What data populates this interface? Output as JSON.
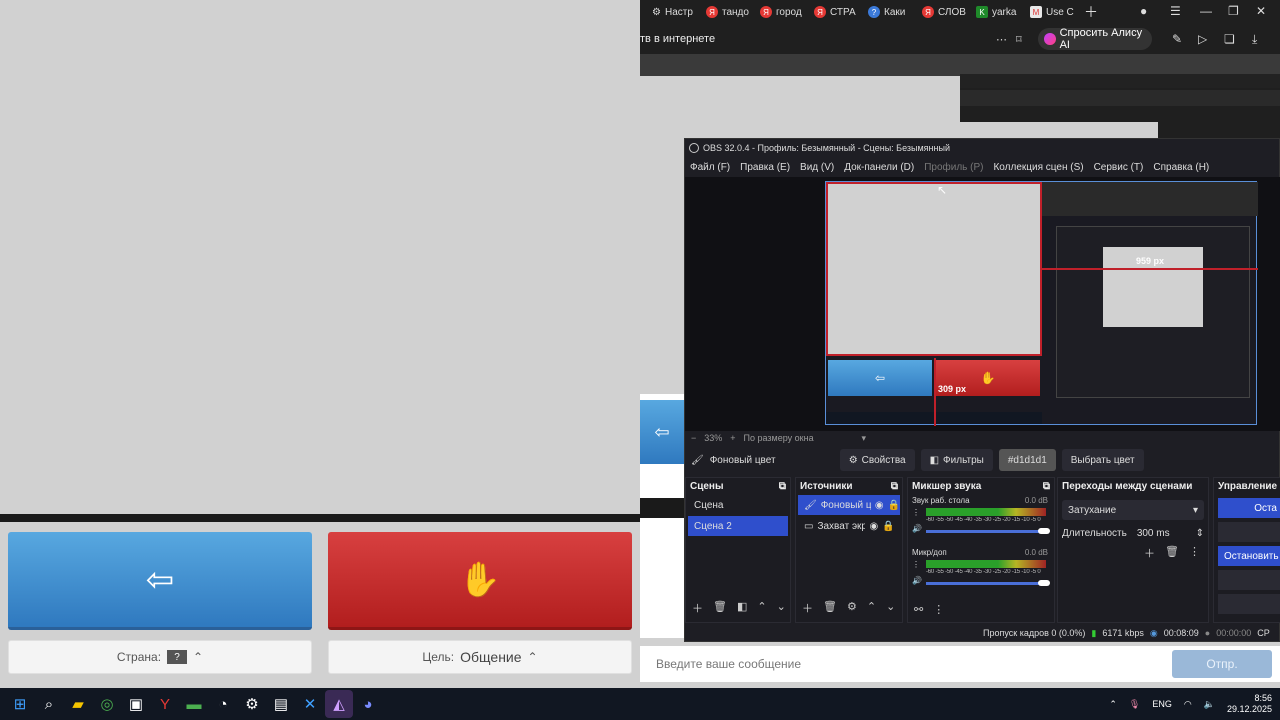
{
  "left": {
    "country_label": "Страна:",
    "country_value": "?",
    "goal_label": "Цель:",
    "goal_value": "Общение"
  },
  "chat": {
    "message_placeholder": "Введите ваше сообщение",
    "send_label": "Отпр."
  },
  "browser": {
    "tabs": [
      "Настр",
      "тандо",
      "город",
      "СТРА",
      "Каки",
      "СЛОВ",
      "yarka",
      "Use C"
    ],
    "address_text": "тв в интернете",
    "alice_label": "Спросить Алису AI"
  },
  "obs": {
    "title": "OBS 32.0.4 - Профиль: Безымянный - Сцены: Безымянный",
    "menu": [
      "Файл (F)",
      "Правка (E)",
      "Вид (V)",
      "Док-панели (D)",
      "Профиль (P)",
      "Коллекция сцен (S)",
      "Сервис (T)",
      "Справка (H)"
    ],
    "zoom": "33%",
    "fit_label": "По размеру окна",
    "dimension_top": "959 px",
    "dimension_left": "309 px",
    "prop_source": "Фоновый цвет",
    "properties_btn": "Свойства",
    "filters_btn": "Фильтры",
    "color_value": "#d1d1d1",
    "choose_color_btn": "Выбрать цвет",
    "scenes_title": "Сцены",
    "scenes": [
      "Сцена",
      "Сцена 2"
    ],
    "sources_title": "Источники",
    "sources": [
      "Фоновый ц",
      "Захват экра"
    ],
    "mixer_title": "Микшер звука",
    "mixer": [
      {
        "name": "Звук раб. стола",
        "db": "0.0 dB"
      },
      {
        "name": "Микр/доп",
        "db": "0.0 dB"
      }
    ],
    "meter_ticks": "-60 -55 -50 -45 -40 -35 -30 -25 -20 -15 -10 -5 0",
    "transitions_title": "Переходы между сценами",
    "transition_value": "Затухание",
    "duration_label": "Длительность",
    "duration_value": "300 ms",
    "controls_title": "Управление",
    "controls": [
      "Оста",
      "Остановить"
    ],
    "status": {
      "dropped": "Пропуск кадров 0 (0.0%)",
      "bitrate": "6171 kbps",
      "rec_time": "00:08:09",
      "stream_time": "00:00:00",
      "cpu": "CP"
    }
  },
  "taskbar": {
    "lang": "ENG",
    "time": "8:56",
    "date": "29.12.2025"
  },
  "colors": {
    "blue_button": "#2f79bf",
    "red_button": "#b21e1e",
    "obs_selection": "#2f4fcc",
    "bg_gray": "#d1d1d1"
  }
}
